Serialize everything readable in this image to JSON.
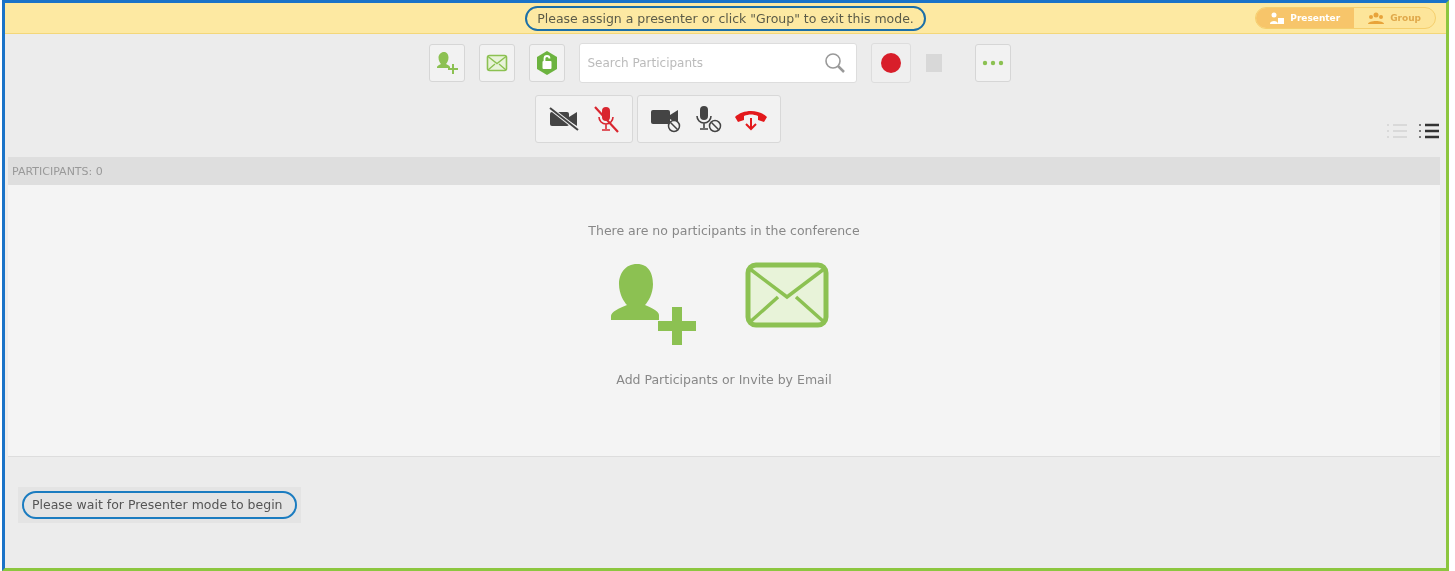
{
  "banner": {
    "message": "Please assign a presenter or click \"Group\" to exit this mode.",
    "highlighted": true
  },
  "mode_toggle": [
    {
      "label": "Presenter",
      "kind": "presenter",
      "selected": true
    },
    {
      "label": "Group",
      "kind": "group",
      "selected": false
    }
  ],
  "toolbar": {
    "search": {
      "placeholder": "Search Participants"
    },
    "record": {
      "recording": false
    },
    "view_toggle": [
      {
        "kind": "plain-list",
        "selected": false
      },
      {
        "kind": "numbered-list",
        "selected": true
      }
    ]
  },
  "participants": {
    "header": "PARTICIPANTS: 0",
    "empty_message": "There are no participants in the conference",
    "hint": "Add Participants or Invite by Email"
  },
  "status": {
    "message": "Please wait for Presenter mode to begin",
    "highlighted": true
  }
}
